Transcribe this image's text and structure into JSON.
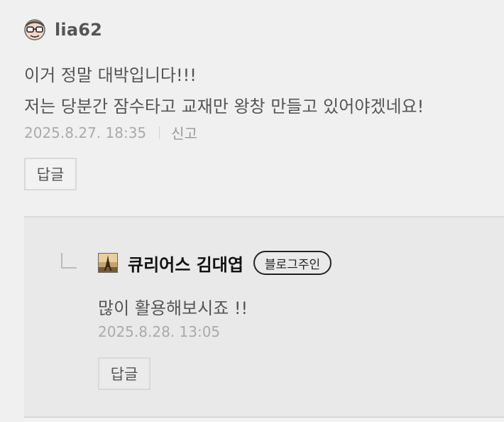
{
  "comment": {
    "username": "lia62",
    "avatar_icon": "glasses-face-icon",
    "lines": [
      "이거 정말 대박입니다!!!",
      "저는 당분간 잠수타고 교재만 왕창 만들고 있어야겠네요!"
    ],
    "timestamp": "2025.8.27. 18:35",
    "report_label": "신고",
    "reply_label": "답글"
  },
  "reply": {
    "arrow_icon": "reply-arrow-icon",
    "avatar_icon": "eiffel-tower-avatar-icon",
    "author": "큐리어스 김대엽",
    "badge": "블로그주인",
    "text": "많이 활용해보시죠 !!",
    "timestamp": "2025.8.28. 13:05",
    "reply_label": "답글"
  },
  "colors": {
    "background": "#f0f0f0",
    "reply_background": "#e9e9e9",
    "meta_text": "#aaaaaa",
    "body_text": "#555555"
  }
}
